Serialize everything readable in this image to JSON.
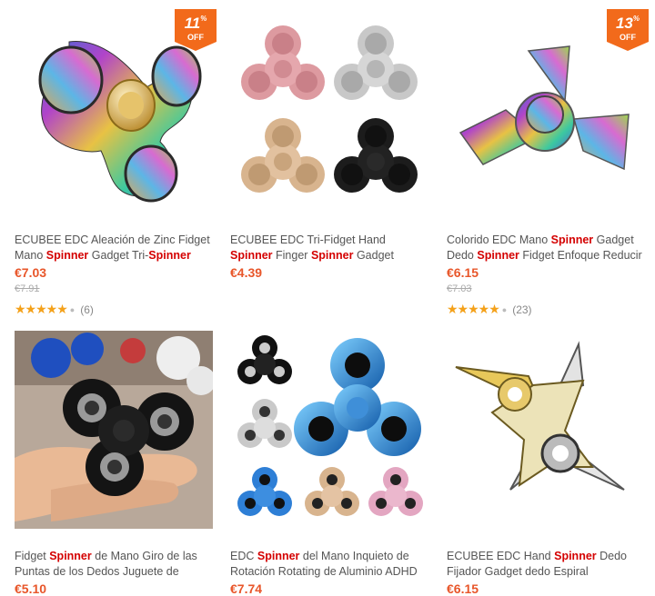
{
  "products": [
    {
      "badge": {
        "value": "11",
        "percent": "%",
        "label": "OFF"
      },
      "title_parts": [
        "ECUBEE EDC Aleación de Zinc Fidget Mano ",
        "Spinner",
        " Gadget Tri-",
        "Spinner"
      ],
      "price": "€7.03",
      "old_price": "€7.91",
      "stars": "★★★★★",
      "review_count": "(6)"
    },
    {
      "title_parts": [
        "ECUBEE EDC Tri-Fidget Hand ",
        "Spinner",
        " Finger ",
        "Spinner",
        " Gadget Enfoque Reducir"
      ],
      "price": "€4.39"
    },
    {
      "badge": {
        "value": "13",
        "percent": "%",
        "label": "OFF"
      },
      "title_parts": [
        "Colorido EDC Mano ",
        "Spinner",
        " Gadget Dedo ",
        "Spinner",
        " Fidget Enfoque Reducir el"
      ],
      "price": "€6.15",
      "old_price": "€7.03",
      "stars": "★★★★★",
      "review_count": "(23)"
    },
    {
      "title_parts": [
        "Fidget ",
        "Spinner",
        " de Mano Giro de las Puntas de los Dedos Juguete de"
      ],
      "price": "€5.10"
    },
    {
      "title_parts": [
        "EDC ",
        "Spinner",
        " del Mano Inquieto de Rotación Rotating de Aluminio ADHD"
      ],
      "price": "€7.74"
    },
    {
      "title_parts": [
        "ECUBEE EDC Hand ",
        "Spinner",
        " Dedo Fijador Gadget dedo Espiral Rodamiento"
      ],
      "price": "€6.15"
    }
  ],
  "colors": {
    "price": "#e8562a",
    "highlight": "#d40000",
    "badge": "#f26a1b",
    "stars": "#f4a11a"
  }
}
